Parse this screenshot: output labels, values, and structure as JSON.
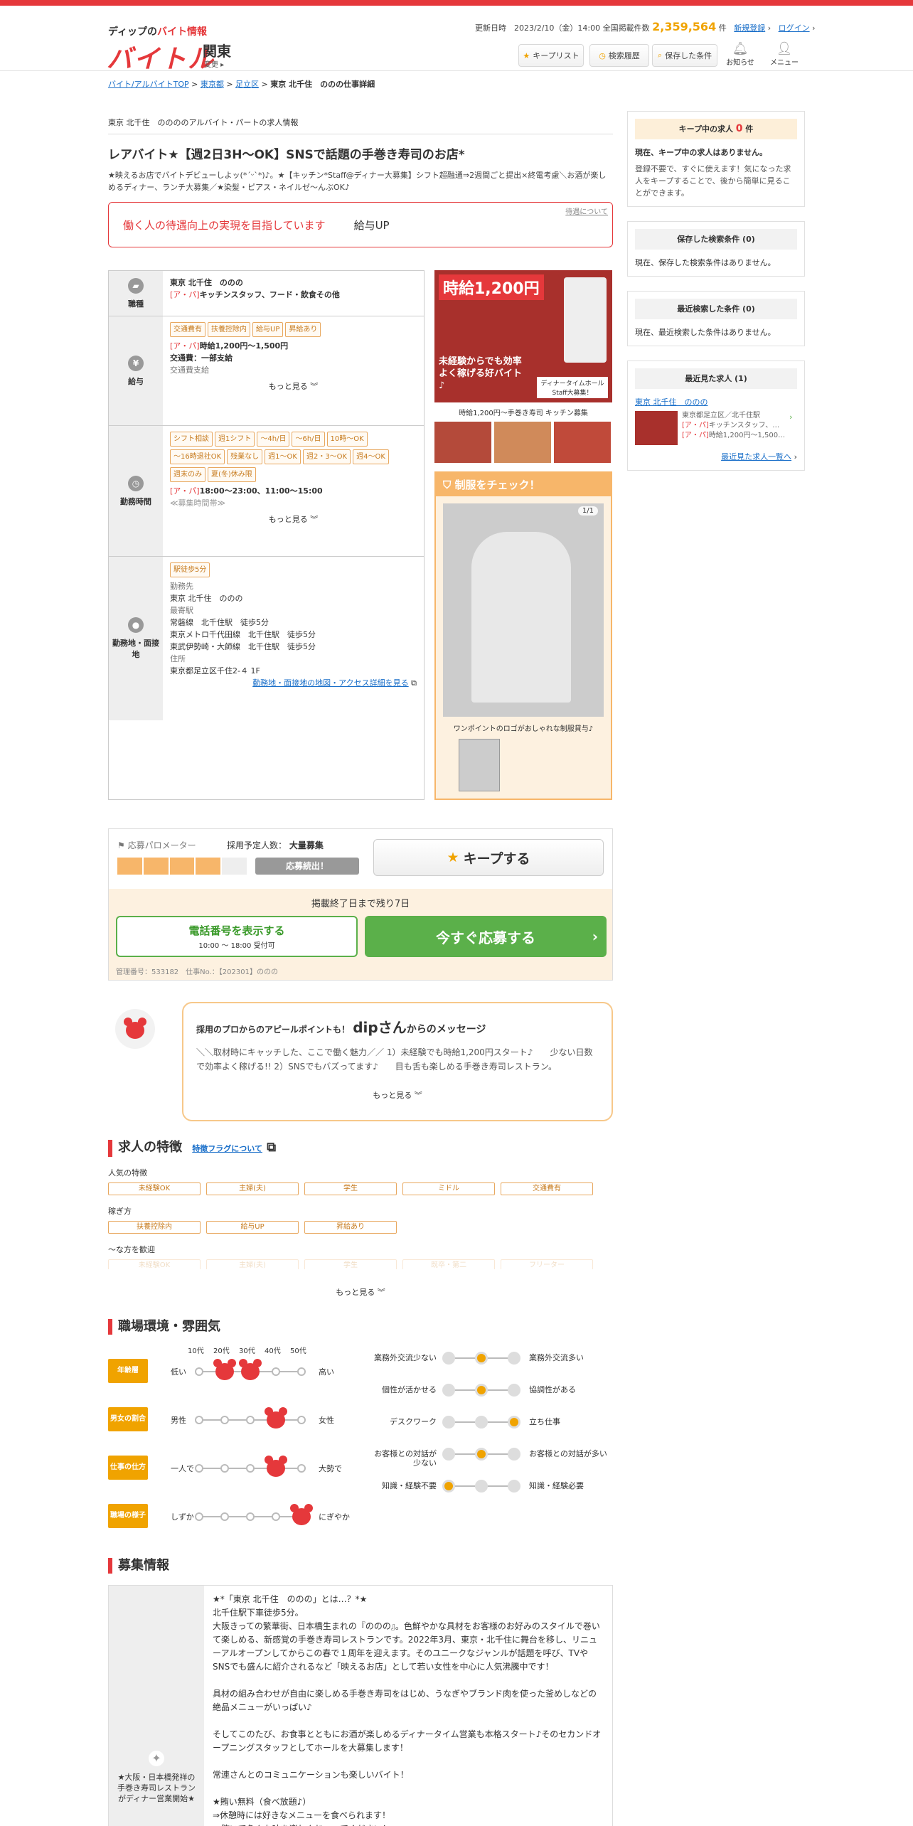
{
  "header": {
    "tagline_pre": "ディップの",
    "tagline_red": "バイト情報",
    "logo": "バイトル",
    "region": "関東",
    "region_change": "変更",
    "updated": "更新日時　2023/2/10（金）14:00 全国掲載件数",
    "count": "2,359,564",
    "count_unit": "件",
    "register": "新規登録",
    "login": "ログイン",
    "keep_list": "キープリスト",
    "history": "検索履歴",
    "saved": "保存した条件",
    "notice": "お知らせ",
    "menu": "メニュー"
  },
  "breadcrumb": {
    "items": [
      "バイト/アルバイトTOP",
      "東京都",
      "足立区"
    ],
    "current": "東京 北千住　ののの仕事詳細"
  },
  "job": {
    "subtitle": "東京 北千住　ののののアルバイト・パートの求人情報",
    "title": "レアバイト★【週2日3H～OK】SNSで話題の手巻き寿司のお店*",
    "desc": "★映えるお店でバイトデビューしよッ(*ˊᵕˋ*)♪。★【キッチン*Staff@ディナー大募集】シフト超融通⇒2週間ごと提出×終電考慮＼お酒が楽しめるディナー、ランチ大募集／★染髪・ピアス・ネイルゼ～んぶOK♪",
    "treat_link": "待遇について",
    "treat_msg": "働く人の待遇向上の実現を目指しています",
    "treat_item": "給与UP"
  },
  "info": {
    "occupation": {
      "label": "職種",
      "place": "東京 北千住　ののの",
      "type_tag": "[ア・パ]",
      "type": "キッチンスタッフ、フード・飲食その他"
    },
    "salary": {
      "label": "給与",
      "tags": [
        "交通費有",
        "扶養控除内",
        "給与UP",
        "昇給あり"
      ],
      "tag_prefix": "[ア・パ]",
      "amount": "時給1,200円～1,500円",
      "transport": "交通費：一部支給",
      "transport_sub": "交通費支給",
      "more": "もっと見る"
    },
    "hours": {
      "label": "勤務時間",
      "tags": [
        "シフト相談",
        "週1シフト",
        "～4h/日",
        "～6h/日",
        "10時～OK",
        "～16時退社OK",
        "残業なし",
        "週1～OK",
        "週2・3～OK",
        "週4～OK",
        "週末のみ",
        "夏(冬)休み限"
      ],
      "tag_prefix": "[ア・パ]",
      "time": "18:00～23:00、11:00～15:00",
      "note": "≪募集時間帯≫",
      "more": "もっと見る"
    },
    "location": {
      "label": "勤務地・面接地",
      "tags": [
        "駅徒歩5分"
      ],
      "work_h": "勤務先",
      "work": "東京 北千住　ののの",
      "station_h": "最寄駅",
      "stations": [
        "常磐線　北千住駅　徒歩5分",
        "東京メトロ千代田線　北千住駅　徒歩5分",
        "東武伊勢崎・大師線　北千住駅　徒歩5分"
      ],
      "addr_h": "住所",
      "addr": "東京都足立区千住2-４ 1F",
      "map_link": "勤務地・面接地の地図・アクセス詳細を見る"
    }
  },
  "photo": {
    "main_text1": "時給1,200円",
    "main_text2": "未経験からでも効率よく稼げる好バイト♪",
    "main_text3": "ディナータイムホールStaff大募集！",
    "caption": "時給1,200円～手巻き寿司 キッチン募集",
    "uniform_title": "制服をチェック！",
    "uniform_count": "1/1",
    "uniform_caption": "ワンポイントのロゴがおしゃれな制服貸与♪"
  },
  "apply": {
    "meter_label": "応募パロメーター",
    "meter_level": 0.8,
    "planned_label": "採用予定人数：",
    "planned": "大量募集",
    "status": "応募続出！",
    "keep": "キープする",
    "remain": "掲載終了日まで残り7日",
    "phone": "電話番号を表示する",
    "phone_hours": "10:00 ～ 18:00 受付可",
    "apply_now": "今すぐ応募する",
    "mgmt": "管理番号：533182　仕事No.：【202301】ののの"
  },
  "message": {
    "lead": "採用のプロからのアピールポイントも！",
    "name": "dipさん",
    "suffix": "からのメッセージ",
    "body": "＼＼取材時にキャッチした、ここで働く魅力／／ 1）未経験でも時給1,200円スタート♪　　少ない日数で効率よく稼げる!! 2）SNSでもバズってます♪　　目も舌も楽しめる手巻き寿司レストラン。",
    "more": "もっと見る"
  },
  "features": {
    "title": "求人の特徴",
    "link": "特徴フラグについて",
    "pop_h": "人気の特徴",
    "pop": [
      "未経験OK",
      "主婦(夫)",
      "学生",
      "ミドル",
      "交通費有"
    ],
    "earn_h": "稼ぎ方",
    "earn": [
      "扶養控除内",
      "給与UP",
      "昇給あり"
    ],
    "welcome_h": "～な方を歓迎",
    "welcome": [
      "未経験OK",
      "主婦(夫)",
      "学生",
      "既卒・第二",
      "フリーター"
    ],
    "more": "もっと見る"
  },
  "env": {
    "title": "職場環境・雰囲気",
    "ages": [
      "10代",
      "20代",
      "30代",
      "40代",
      "50代"
    ],
    "rows": [
      {
        "label": "年齢層",
        "left": "低い",
        "right": "高い",
        "pos": [
          1,
          2
        ]
      },
      {
        "label": "男女の割合",
        "left": "男性",
        "right": "女性",
        "pos": [
          3
        ]
      },
      {
        "label": "仕事の仕方",
        "left": "一人で",
        "right": "大勢で",
        "pos": [
          3
        ]
      },
      {
        "label": "職場の様子",
        "left": "しずか",
        "right": "にぎやか",
        "pos": [
          4
        ]
      }
    ],
    "radio": [
      {
        "left": "業務外交流少ない",
        "right": "業務外交流多い",
        "pos": 1
      },
      {
        "left": "個性が活かせる",
        "right": "協調性がある",
        "pos": 1
      },
      {
        "left": "デスクワーク",
        "right": "立ち仕事",
        "pos": 2
      },
      {
        "left": "お客様との対話が少ない",
        "right": "お客様との対話が多い",
        "pos": 1
      },
      {
        "left": "知識・経験不要",
        "right": "知識・経験必要",
        "pos": 0
      }
    ]
  },
  "recruit": {
    "title": "募集情報",
    "side": "★大阪・日本橋発祥の手巻き寿司レストランがディナー営業開始★",
    "lines": [
      "★*「東京 北千住　ののの」とは…？*★",
      "北千住駅下車徒歩5分。",
      "大阪きっての繁華街、日本橋生まれの『ののの』。色鮮やかな具材をお客様のお好みのスタイルで巻いて楽しめる、新感覚の手巻き寿司レストランです。2022年3月、東京・北千住に舞台を移し、リニューアルオープンしてからこの春で１周年を迎えます。そのユニークなジャンルが話題を呼び、TVやSNSでも盛んに紹介されるなど「映えるお店」として若い女性を中心に人気沸騰中です！",
      "",
      "具材の組み合わせが自由に楽しめる手巻き寿司をはじめ、うなぎやブランド肉を使った釜めしなどの絶品メニューがいっぱい♪",
      "",
      "そしてこのたび、お食事とともにお酒が楽しめるディナータイム営業も本格スタート♪そのセカンドオープニングスタッフとしてホールを大募集します！",
      "",
      "常連さんとのコミュニケーションも楽しいバイト！",
      "",
      "★賄い無料（食べ放題♪）",
      "⇒休憩時には好きなメニューを食べられます！",
      "　賄いで色んな味を楽しんじゃってください！"
    ]
  },
  "side": {
    "keep_title": "キープ中の求人",
    "keep_count": "0",
    "keep_unit": "件",
    "keep_msg": "現在、キープ中の求人はありません。",
    "keep_sub": "登録不要で、すぐに使えます！気になった求人をキープすることで、後から簡単に見ることができます。",
    "saved_title": "保存した検索条件 (0)",
    "saved_msg": "現在、保存した検索条件はありません。",
    "recent_s_title": "最近検索した条件 (0)",
    "recent_s_msg": "現在、最近検索した条件はありません。",
    "recent_j_title": "最近見た求人 (1)",
    "recent_j_name": "東京 北千住　ののの",
    "recent_j_addr": "東京都足立区／北千住駅",
    "recent_j_type": "キッチンスタッフ、…",
    "recent_j_pay": "時給1,200円～1,500…",
    "recent_j_prefix": "[ア・パ]",
    "recent_j_all": "最近見た求人一覧へ"
  }
}
